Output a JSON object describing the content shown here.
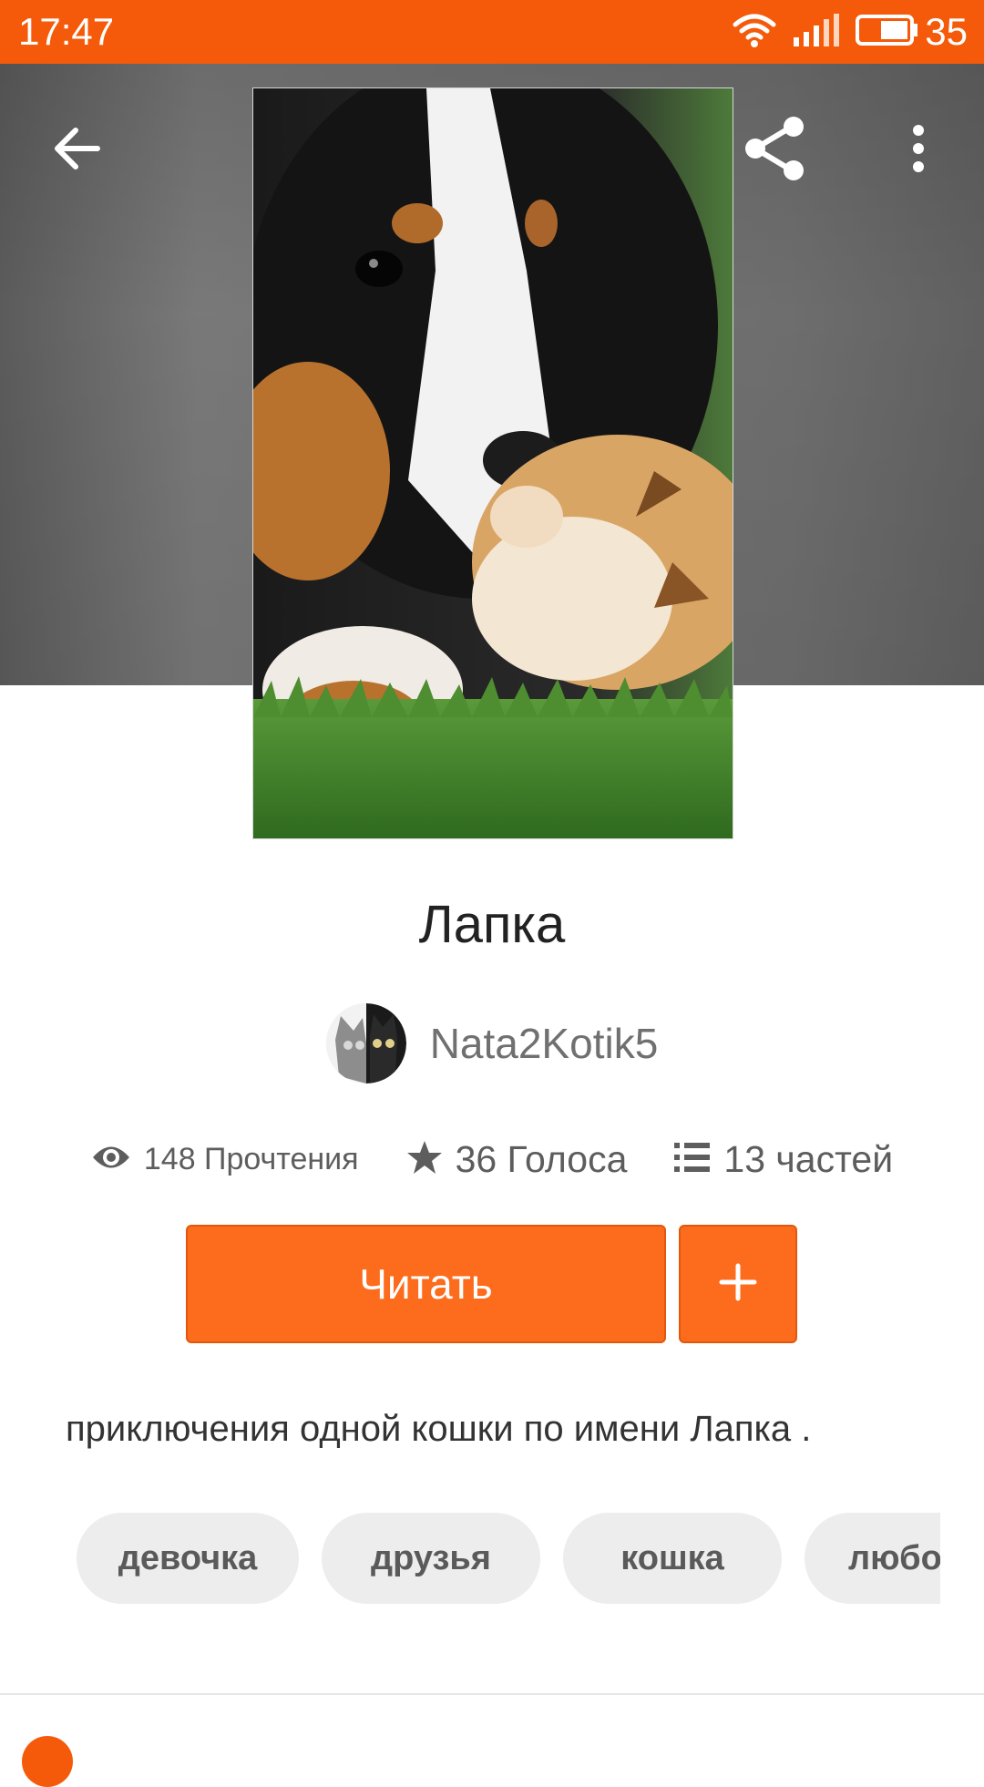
{
  "status_bar": {
    "time": "17:47",
    "battery_level": "35",
    "icons": [
      "wifi-icon",
      "signal-icon",
      "battery-icon"
    ]
  },
  "toolbar": {
    "icons": [
      "back-arrow-icon",
      "share-icon",
      "more-vert-icon"
    ]
  },
  "story": {
    "cover_image": "puppy-and-kitten-cover",
    "title": "Лапка",
    "author": {
      "avatar": "two-cats-avatar",
      "name": "Nata2Kotik5"
    },
    "stats": {
      "reads": "148 Прочтения",
      "votes": "36 Голоса",
      "parts": "13 частей"
    },
    "read_button": "Читать",
    "add_button": "+",
    "description": "приключения одной кошки по имени Лапка .",
    "tags": [
      "девочка",
      "друзья",
      "кошка",
      "любовь"
    ]
  },
  "colors": {
    "accent": "#f45a0a",
    "button": "#fd6b1c",
    "tag_bg": "#ededee"
  }
}
